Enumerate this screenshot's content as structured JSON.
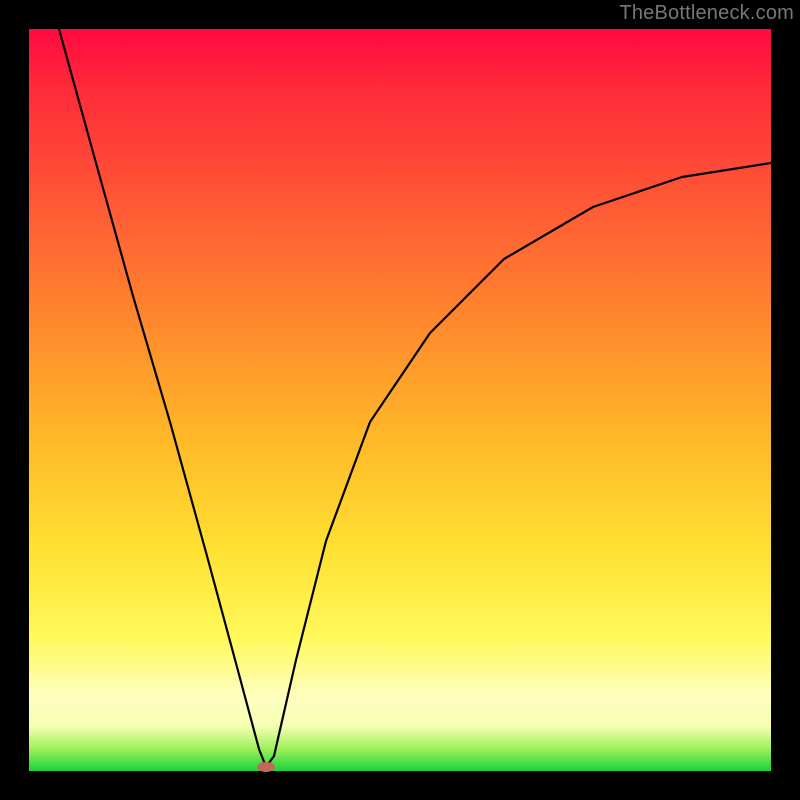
{
  "watermark": "TheBottleneck.com",
  "chart_data": {
    "type": "line",
    "title": "",
    "xlabel": "",
    "ylabel": "",
    "xlim": [
      0,
      100
    ],
    "ylim": [
      0,
      100
    ],
    "grid": false,
    "legend": false,
    "series": [
      {
        "name": "curve",
        "color": "#000000",
        "points": [
          {
            "x": 4,
            "y": 100
          },
          {
            "x": 9,
            "y": 82
          },
          {
            "x": 14,
            "y": 64
          },
          {
            "x": 19,
            "y": 47
          },
          {
            "x": 24,
            "y": 29
          },
          {
            "x": 28,
            "y": 14
          },
          {
            "x": 31,
            "y": 3
          },
          {
            "x": 32,
            "y": 0.5
          },
          {
            "x": 33,
            "y": 2
          },
          {
            "x": 36,
            "y": 15
          },
          {
            "x": 40,
            "y": 31
          },
          {
            "x": 46,
            "y": 47
          },
          {
            "x": 54,
            "y": 59
          },
          {
            "x": 64,
            "y": 69
          },
          {
            "x": 76,
            "y": 76
          },
          {
            "x": 88,
            "y": 80
          },
          {
            "x": 100,
            "y": 82
          }
        ]
      }
    ],
    "marker": {
      "x": 32,
      "y": 0.5,
      "color": "#c1685a",
      "rx": 9,
      "ry": 5
    },
    "background_gradient": {
      "stops": [
        {
          "pos": 0,
          "color": "#ff0a3f"
        },
        {
          "pos": 40,
          "color": "#ff8a2d"
        },
        {
          "pos": 70,
          "color": "#ffe032"
        },
        {
          "pos": 90,
          "color": "#ffffc0"
        },
        {
          "pos": 100,
          "color": "#18d43c"
        }
      ]
    }
  }
}
